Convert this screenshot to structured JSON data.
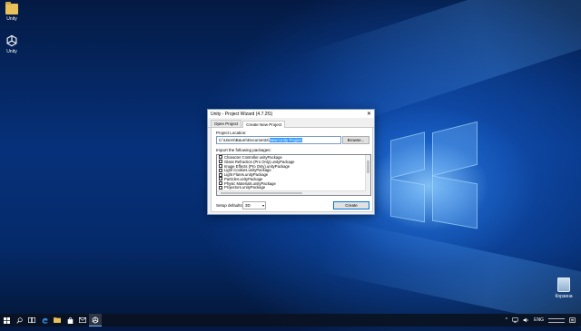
{
  "desktop": {
    "icons": [
      {
        "label": "Unity",
        "icon": "folder-icon"
      },
      {
        "label": "Unity",
        "icon": "unity-icon"
      },
      {
        "label": "Корзина",
        "icon": "recycle-bin-icon"
      }
    ]
  },
  "dialog": {
    "title": "Unity - Project Wizard (4.7.2f1)",
    "close_glyph": "✕",
    "tabs": [
      {
        "label": "Open Project",
        "active": false
      },
      {
        "label": "Create New Project",
        "active": true
      }
    ],
    "project_location_label": "Project Location:",
    "project_location_value": "C:\\Users\\Baum\\Documents\\",
    "project_location_selected": "New Unity Project",
    "browse_label": "Browse...",
    "import_label": "Import the following packages:",
    "packages": [
      "Character Controller.unityPackage",
      "Glass Refraction (Pro Only).unityPackage",
      "Image Effects (Pro Only).unityPackage",
      "Light Cookies.unityPackage",
      "Light Flares.unityPackage",
      "Particles.unityPackage",
      "Physic Materials.unityPackage",
      "Projectors.unityPackage"
    ],
    "setup_defaults_label": "Setup defaults for:",
    "setup_defaults_value": "3D",
    "create_label": "Create"
  },
  "taskbar": {
    "items": [
      {
        "icon": "windows-start-icon"
      },
      {
        "icon": "search-icon"
      },
      {
        "icon": "task-view-icon"
      },
      {
        "icon": "edge-icon"
      },
      {
        "icon": "file-explorer-icon"
      },
      {
        "icon": "store-icon"
      },
      {
        "icon": "mail-icon"
      },
      {
        "icon": "unity-icon"
      }
    ],
    "tray": {
      "language": "ENG"
    }
  }
}
